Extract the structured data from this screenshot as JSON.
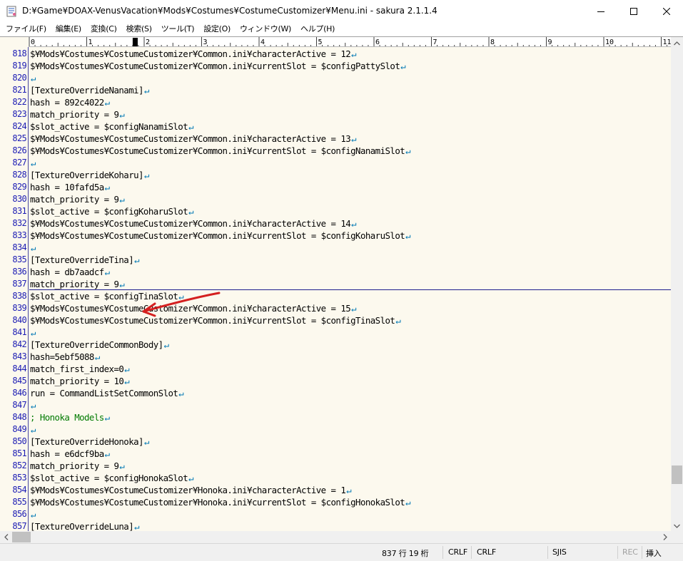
{
  "window": {
    "title": "D:¥Game¥DOAX-VenusVacation¥Mods¥Costumes¥CostumeCustomizer¥Menu.ini - sakura 2.1.1.4"
  },
  "menu": [
    "ファイル(F)",
    "編集(E)",
    "変換(C)",
    "検索(S)",
    "ツール(T)",
    "設定(O)",
    "ウィンドウ(W)",
    "ヘルプ(H)"
  ],
  "ruler": {
    "labels": [
      "0",
      "1",
      "2",
      "3",
      "4",
      "5",
      "6",
      "7",
      "8",
      "9",
      "10",
      "11"
    ]
  },
  "editor": {
    "lines": [
      {
        "num": "818",
        "text": "$¥Mods¥Costumes¥CostumeCustomizer¥Common.ini¥characterActive = 12",
        "type": "code"
      },
      {
        "num": "819",
        "text": "$¥Mods¥Costumes¥CostumeCustomizer¥Common.ini¥currentSlot = $configPattySlot",
        "type": "code"
      },
      {
        "num": "820",
        "text": "",
        "type": "code"
      },
      {
        "num": "821",
        "text": "[TextureOverrideNanami]",
        "type": "code"
      },
      {
        "num": "822",
        "text": "hash = 892c4022",
        "type": "code"
      },
      {
        "num": "823",
        "text": "match_priority = 9",
        "type": "code"
      },
      {
        "num": "824",
        "text": "$slot_active = $configNanamiSlot",
        "type": "code"
      },
      {
        "num": "825",
        "text": "$¥Mods¥Costumes¥CostumeCustomizer¥Common.ini¥characterActive = 13",
        "type": "code"
      },
      {
        "num": "826",
        "text": "$¥Mods¥Costumes¥CostumeCustomizer¥Common.ini¥currentSlot = $configNanamiSlot",
        "type": "code"
      },
      {
        "num": "827",
        "text": "",
        "type": "code"
      },
      {
        "num": "828",
        "text": "[TextureOverrideKoharu]",
        "type": "code"
      },
      {
        "num": "829",
        "text": "hash = 10fafd5a",
        "type": "code"
      },
      {
        "num": "830",
        "text": "match_priority = 9",
        "type": "code"
      },
      {
        "num": "831",
        "text": "$slot_active = $configKoharuSlot",
        "type": "code"
      },
      {
        "num": "832",
        "text": "$¥Mods¥Costumes¥CostumeCustomizer¥Common.ini¥characterActive = 14",
        "type": "code"
      },
      {
        "num": "833",
        "text": "$¥Mods¥Costumes¥CostumeCustomizer¥Common.ini¥currentSlot = $configKoharuSlot",
        "type": "code"
      },
      {
        "num": "834",
        "text": "",
        "type": "code"
      },
      {
        "num": "835",
        "text": "[TextureOverrideTina]",
        "type": "code"
      },
      {
        "num": "836",
        "text": "hash = db7aadcf",
        "type": "code"
      },
      {
        "num": "837",
        "text": "match_priority = 9",
        "type": "code"
      },
      {
        "num": "838",
        "text": "$slot_active = $configTinaSlot",
        "type": "code"
      },
      {
        "num": "839",
        "text": "$¥Mods¥Costumes¥CostumeCustomizer¥Common.ini¥characterActive = 15",
        "type": "code"
      },
      {
        "num": "840",
        "text": "$¥Mods¥Costumes¥CostumeCustomizer¥Common.ini¥currentSlot = $configTinaSlot",
        "type": "code"
      },
      {
        "num": "841",
        "text": "",
        "type": "code"
      },
      {
        "num": "842",
        "text": "[TextureOverrideCommonBody]",
        "type": "code"
      },
      {
        "num": "843",
        "text": "hash=5ebf5088",
        "type": "code"
      },
      {
        "num": "844",
        "text": "match_first_index=0",
        "type": "code"
      },
      {
        "num": "845",
        "text": "match_priority = 10",
        "type": "code"
      },
      {
        "num": "846",
        "text": "run = CommandListSetCommonSlot",
        "type": "code"
      },
      {
        "num": "847",
        "text": "",
        "type": "code"
      },
      {
        "num": "848",
        "text": "; Honoka Models",
        "type": "comment"
      },
      {
        "num": "849",
        "text": "",
        "type": "code"
      },
      {
        "num": "850",
        "text": "[TextureOverrideHonoka]",
        "type": "code"
      },
      {
        "num": "851",
        "text": "hash = e6dcf9ba",
        "type": "code"
      },
      {
        "num": "852",
        "text": "match_priority = 9",
        "type": "code"
      },
      {
        "num": "853",
        "text": "$slot_active = $configHonokaSlot",
        "type": "code"
      },
      {
        "num": "854",
        "text": "$¥Mods¥Costumes¥CostumeCustomizer¥Honoka.ini¥characterActive = 1",
        "type": "code"
      },
      {
        "num": "855",
        "text": "$¥Mods¥Costumes¥CostumeCustomizer¥Honoka.ini¥currentSlot = $configHonokaSlot",
        "type": "code"
      },
      {
        "num": "856",
        "text": "",
        "type": "code"
      },
      {
        "num": "857",
        "text": "[TextureOverrideLuna]",
        "type": "code"
      }
    ],
    "cursor_line": "837",
    "eol_mark": "↵"
  },
  "status": {
    "position": "837 行  19 桁",
    "eol_1": "CRLF",
    "eol_2": "CRLF",
    "encoding": "SJIS",
    "rec": "REC",
    "insert_mode": "挿入"
  },
  "colors": {
    "editor_bg": "#fcf9ee",
    "line_number": "#1c1cb4",
    "comment": "#007a00",
    "eol_mark": "#0078b4",
    "annotation_arrow": "#d42020"
  }
}
